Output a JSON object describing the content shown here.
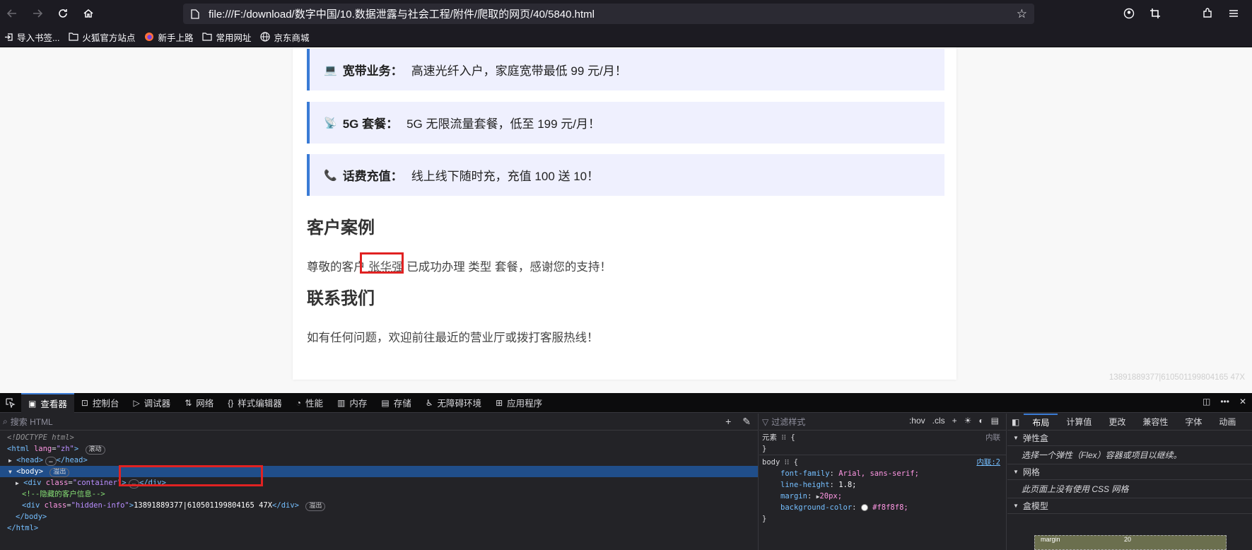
{
  "browser": {
    "url": "file:///F:/download/数字中国/10.数据泄露与社会工程/附件/爬取的网页/40/5840.html",
    "bookmarks": [
      {
        "label": "导入书签...",
        "icon": "import-icon"
      },
      {
        "label": "火狐官方站点",
        "icon": "folder-icon"
      },
      {
        "label": "新手上路",
        "icon": "firefox-icon"
      },
      {
        "label": "常用网址",
        "icon": "folder-icon"
      },
      {
        "label": "京东商城",
        "icon": "globe-icon"
      }
    ]
  },
  "page": {
    "cards": [
      {
        "emoji": "💻",
        "title": "宽带业务：",
        "text": "高速光纤入户，家庭宽带最低 99 元/月！"
      },
      {
        "emoji": "📡",
        "title": "5G 套餐：",
        "text": "5G 无限流量套餐，低至 199 元/月！"
      },
      {
        "emoji": "📞",
        "title": "话费充值：",
        "text": "线上线下随时充，充值 100 送 10！"
      }
    ],
    "case_title": "客户案例",
    "case_prefix": "尊敬的客户",
    "case_name": "张华强",
    "case_suffix": "已成功办理 类型 套餐，感谢您的支持！",
    "contact_title": "联系我们",
    "contact_text": "如有任何问题，欢迎前往最近的营业厅或拨打客服热线！",
    "hidden_info": "13891889377|610501199804165 47X"
  },
  "devtools": {
    "tabs": [
      "查看器",
      "控制台",
      "调试器",
      "网络",
      "样式编辑器",
      "性能",
      "内存",
      "存储",
      "无障碍环境",
      "应用程序"
    ],
    "search_placeholder": "搜索 HTML",
    "html": {
      "doctype": "<!DOCTYPE html>",
      "html_open": "<html",
      "lang_attr": "lang",
      "lang_val": "\"zh\"",
      "html_badge": "滚动",
      "head": "<head>",
      "head_close": "</head>",
      "body": "<body>",
      "body_badge": "溢出",
      "div_container": "<div",
      "class_attr": "class",
      "container_val": "\"container\"",
      "div_close": "</div>",
      "comment": "<!--隐藏的客户信息-->",
      "hidden_val": "\"hidden-info\"",
      "hidden_text": "13891889377|610501199804165 47X",
      "hidden_badge": "溢出",
      "body_close": "</body>",
      "html_close": "</html>"
    },
    "styles": {
      "filter_placeholder": "过滤样式",
      "hov": ":hov",
      "cls": ".cls",
      "element_rule": "元素",
      "inline_label": "内联",
      "body_selector": "body",
      "body_source": "内联:2",
      "props": [
        {
          "name": "font-family",
          "value": "Arial, sans-serif;"
        },
        {
          "name": "line-height",
          "value": "1.8;"
        },
        {
          "name": "margin",
          "value": "20px;"
        },
        {
          "name": "background-color",
          "value": "#f8f8f8;"
        }
      ]
    },
    "layout": {
      "tabs": [
        "布局",
        "计算值",
        "更改",
        "兼容性",
        "字体",
        "动画"
      ],
      "flex_title": "弹性盒",
      "flex_note": "选择一个弹性（Flex）容器或项目以继续。",
      "grid_title": "网格",
      "grid_note": "此页面上没有使用 CSS 网格",
      "box_title": "盒模型",
      "box_margin": "margin",
      "box_value": "20"
    }
  }
}
